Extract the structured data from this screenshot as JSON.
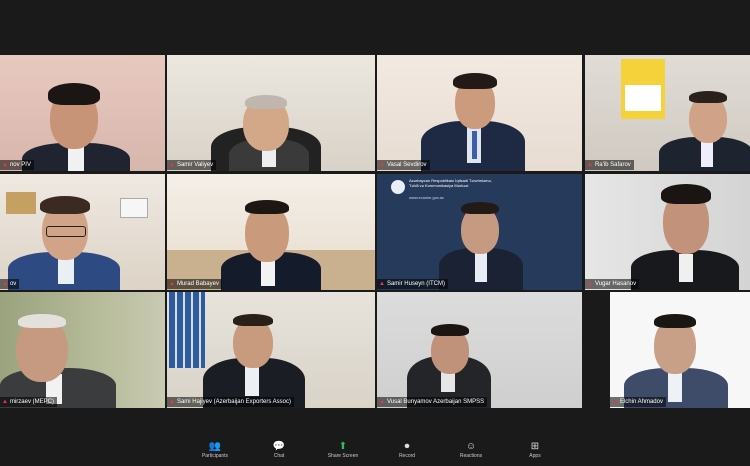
{
  "meeting": {
    "participants": [
      {
        "name": "nov PIV",
        "active": false
      },
      {
        "name": "Samir Valiyev",
        "active": true
      },
      {
        "name": "Vasal Sevdirov",
        "active": false
      },
      {
        "name": "Ra'ib Safarov",
        "active": false
      },
      {
        "name": "ov",
        "active": false
      },
      {
        "name": "Murad Babayev",
        "active": false
      },
      {
        "name": "Samir Huseyn (ITCM)",
        "active": false
      },
      {
        "name": "Vugar Hasanov",
        "active": false
      },
      {
        "name": "mirzaev (MEPC)",
        "active": false
      },
      {
        "name": "Sami Hajiyev (Azerbaijan Exporters Assoc)",
        "active": false
      },
      {
        "name": "Vusal Bunyamov Azerbaijan SMPSS",
        "active": false
      },
      {
        "name": "Elchin Ahmadov",
        "active": false
      }
    ],
    "logo_text": "Azərbaycan Respublikası İqtisadi Tənzimləmə, Təhlil və Kommunikasiya Mərkəzi",
    "logo_url": "www.ecosim.gov.az"
  },
  "toolbar": {
    "items": [
      {
        "label": "Participants",
        "icon": "participants-icon"
      },
      {
        "label": "Chat",
        "icon": "chat-icon"
      },
      {
        "label": "Share Screen",
        "icon": "share-screen-icon"
      },
      {
        "label": "Record",
        "icon": "record-icon"
      },
      {
        "label": "Reactions",
        "icon": "reactions-icon"
      },
      {
        "label": "Apps",
        "icon": "apps-icon"
      }
    ]
  },
  "colors": {
    "accent": "#b6d36b",
    "share": "#2fbf4f",
    "mic_off": "#e34"
  }
}
